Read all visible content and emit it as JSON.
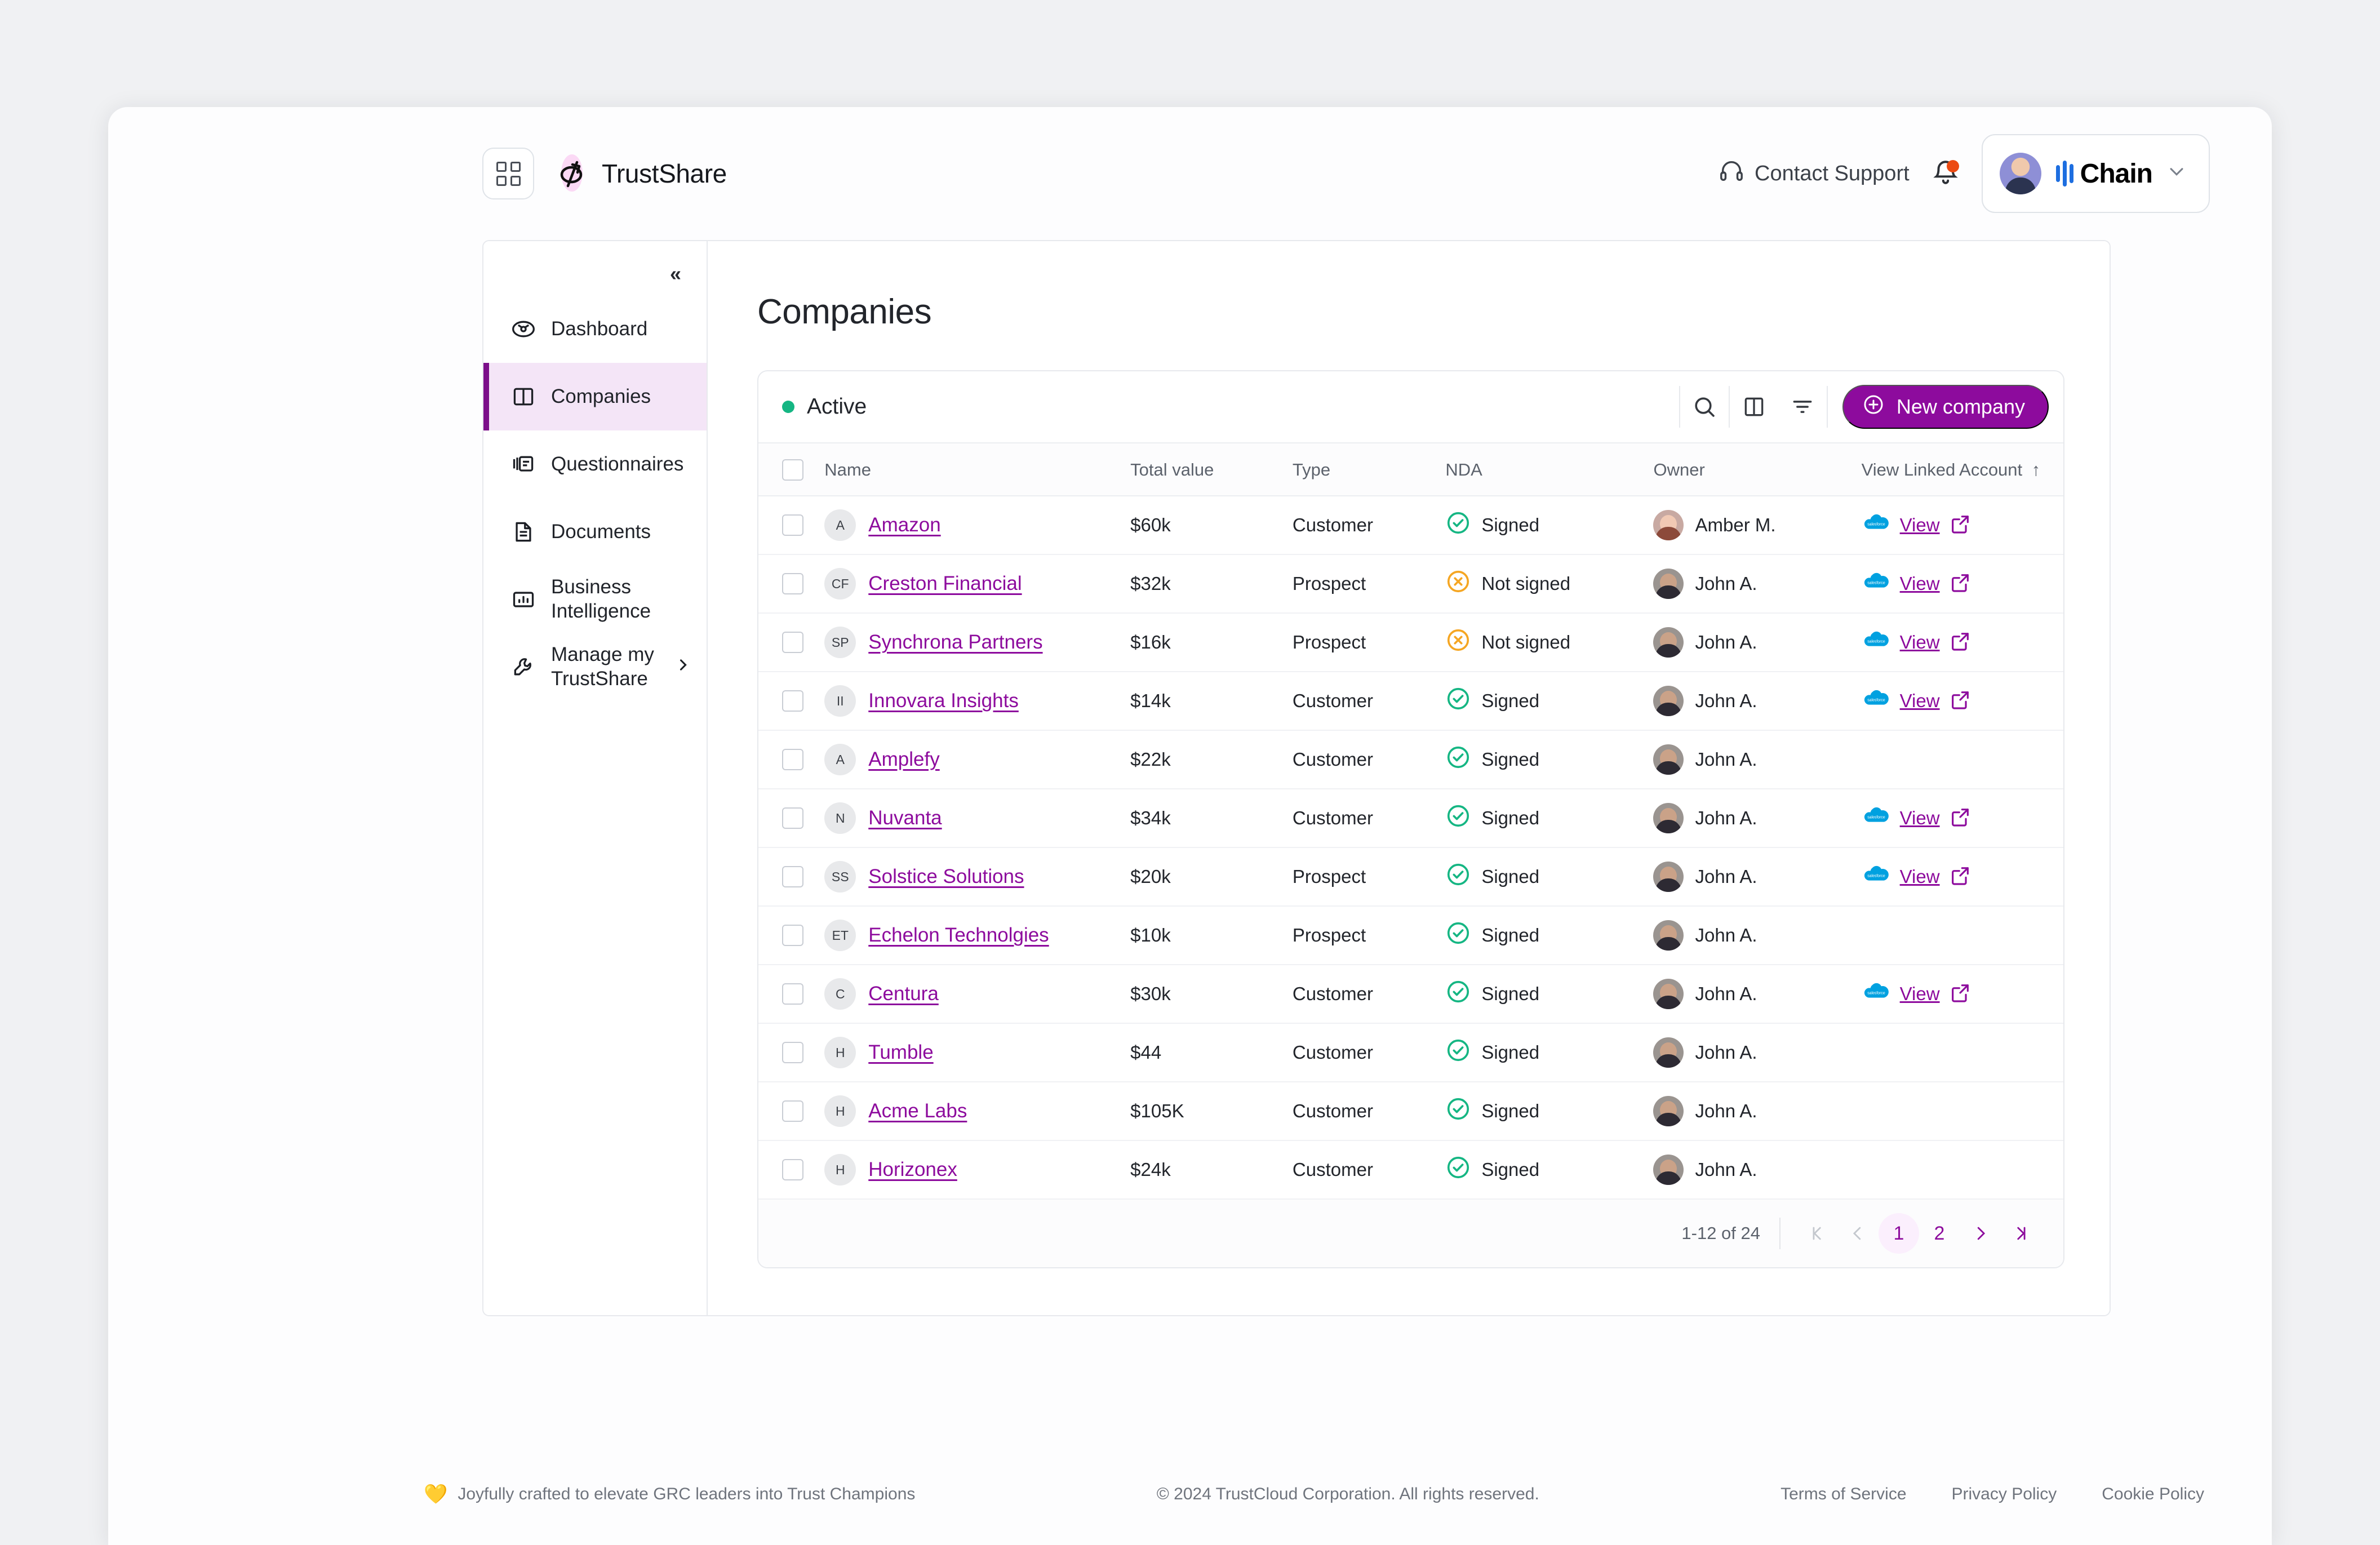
{
  "topbar": {
    "apps_icon": "grid-apps-icon",
    "brand_name": "TrustShare",
    "support_label": "Contact Support",
    "support_icon": "headset-icon",
    "notifications_icon": "bell-icon",
    "account_name": "Chain",
    "account_chevron": "chevron-down-icon",
    "avatar": "user-avatar"
  },
  "sidebar": {
    "collapse_icon": "chevrons-left-icon",
    "collapse_label": "«",
    "items": [
      {
        "label": "Dashboard",
        "icon": "dashboard-icon",
        "active": false
      },
      {
        "label": "Companies",
        "icon": "companies-icon",
        "active": true
      },
      {
        "label": "Questionnaires",
        "icon": "questionnaires-icon",
        "active": false
      },
      {
        "label": "Documents",
        "icon": "documents-icon",
        "active": false
      },
      {
        "label": "Business Intelligence",
        "icon": "bar-chart-icon",
        "active": false
      },
      {
        "label": "Manage my TrustShare",
        "icon": "wrench-icon",
        "active": false,
        "chevron": "chevron-right-icon"
      }
    ]
  },
  "main": {
    "page_title": "Companies",
    "card": {
      "status_label": "Active",
      "status_color": "#15b683",
      "tools": [
        {
          "name": "search-icon",
          "label": "search"
        },
        {
          "name": "columns-icon",
          "label": "columns"
        },
        {
          "name": "filter-icon",
          "label": "filter"
        }
      ],
      "new_button": {
        "label": "New company",
        "icon": "plus-circle-icon",
        "color": "#8d0b9d"
      }
    },
    "table": {
      "columns": [
        "Name",
        "Total value",
        "Type",
        "NDA",
        "Owner",
        "View Linked Account"
      ],
      "sort_column": "View Linked Account",
      "sort_icon": "arrow-up-icon",
      "select_all_checkbox": false,
      "rows": [
        {
          "initials": "A",
          "name": "Amazon",
          "total_value": "$60k",
          "type": "Customer",
          "nda": "Signed",
          "owner": "Amber M.",
          "owner_avatar": "amber",
          "linked": true,
          "link_label": "View",
          "link_icon": "salesforce-icon"
        },
        {
          "initials": "CF",
          "name": "Creston Financial",
          "total_value": "$32k",
          "type": "Prospect",
          "nda": "Not signed",
          "owner": "John A.",
          "owner_avatar": "john",
          "linked": true,
          "link_label": "View",
          "link_icon": "salesforce-icon"
        },
        {
          "initials": "SP",
          "name": "Synchrona Partners",
          "total_value": "$16k",
          "type": "Prospect",
          "nda": "Not signed",
          "owner": "John A.",
          "owner_avatar": "john",
          "linked": true,
          "link_label": "View",
          "link_icon": "salesforce-icon"
        },
        {
          "initials": "II",
          "name": "Innovara Insights",
          "total_value": "$14k",
          "type": "Customer",
          "nda": "Signed",
          "owner": "John A.",
          "owner_avatar": "john",
          "linked": true,
          "link_label": "View",
          "link_icon": "salesforce-icon"
        },
        {
          "initials": "A",
          "name": "Amplefy",
          "total_value": "$22k",
          "type": "Customer",
          "nda": "Signed",
          "owner": "John A.",
          "owner_avatar": "john",
          "linked": false,
          "link_label": "",
          "link_icon": ""
        },
        {
          "initials": "N",
          "name": "Nuvanta",
          "total_value": "$34k",
          "type": "Customer",
          "nda": "Signed",
          "owner": "John A.",
          "owner_avatar": "john",
          "linked": true,
          "link_label": "View",
          "link_icon": "salesforce-icon"
        },
        {
          "initials": "SS",
          "name": "Solstice Solutions",
          "total_value": "$20k",
          "type": "Prospect",
          "nda": "Signed",
          "owner": "John A.",
          "owner_avatar": "john",
          "linked": true,
          "link_label": "View",
          "link_icon": "salesforce-icon"
        },
        {
          "initials": "ET",
          "name": "Echelon Technolgies",
          "total_value": "$10k",
          "type": "Prospect",
          "nda": "Signed",
          "owner": "John A.",
          "owner_avatar": "john",
          "linked": false,
          "link_label": "",
          "link_icon": ""
        },
        {
          "initials": "C",
          "name": "Centura",
          "total_value": "$30k",
          "type": "Customer",
          "nda": "Signed",
          "owner": "John A.",
          "owner_avatar": "john",
          "linked": true,
          "link_label": "View",
          "link_icon": "salesforce-icon"
        },
        {
          "initials": "H",
          "name": "Tumble",
          "total_value": "$44",
          "type": "Customer",
          "nda": "Signed",
          "owner": "John A.",
          "owner_avatar": "john",
          "linked": false,
          "link_label": "",
          "link_icon": ""
        },
        {
          "initials": "H",
          "name": "Acme Labs",
          "total_value": "$105K",
          "type": "Customer",
          "nda": "Signed",
          "owner": "John A.",
          "owner_avatar": "john",
          "linked": false,
          "link_label": "",
          "link_icon": ""
        },
        {
          "initials": "H",
          "name": "Horizonex",
          "total_value": "$24k",
          "type": "Customer",
          "nda": "Signed",
          "owner": "John A.",
          "owner_avatar": "john",
          "linked": false,
          "link_label": "",
          "link_icon": ""
        }
      ]
    },
    "pagination": {
      "range_label": "1-12 of 24",
      "first_icon": "chevron-first-icon",
      "prev_icon": "chevron-left-icon",
      "pages": [
        "1",
        "2"
      ],
      "current_page": "1",
      "next_icon": "chevron-right-icon",
      "last_icon": "chevron-last-icon"
    }
  },
  "footer": {
    "heart_icon": "yellow-heart-icon",
    "tagline": "Joyfully crafted to elevate GRC leaders into Trust Champions",
    "copyright": "© 2024 TrustCloud Corporation. All rights reserved.",
    "links": [
      "Terms of Service",
      "Privacy Policy",
      "Cookie Policy"
    ]
  },
  "colors": {
    "accent_purple": "#8d0b9d",
    "active_nav_bg": "#f4e5f7",
    "signed_green": "#15b683",
    "not_signed_orange": "#f5a623",
    "salesforce_blue": "#00a1e0"
  }
}
